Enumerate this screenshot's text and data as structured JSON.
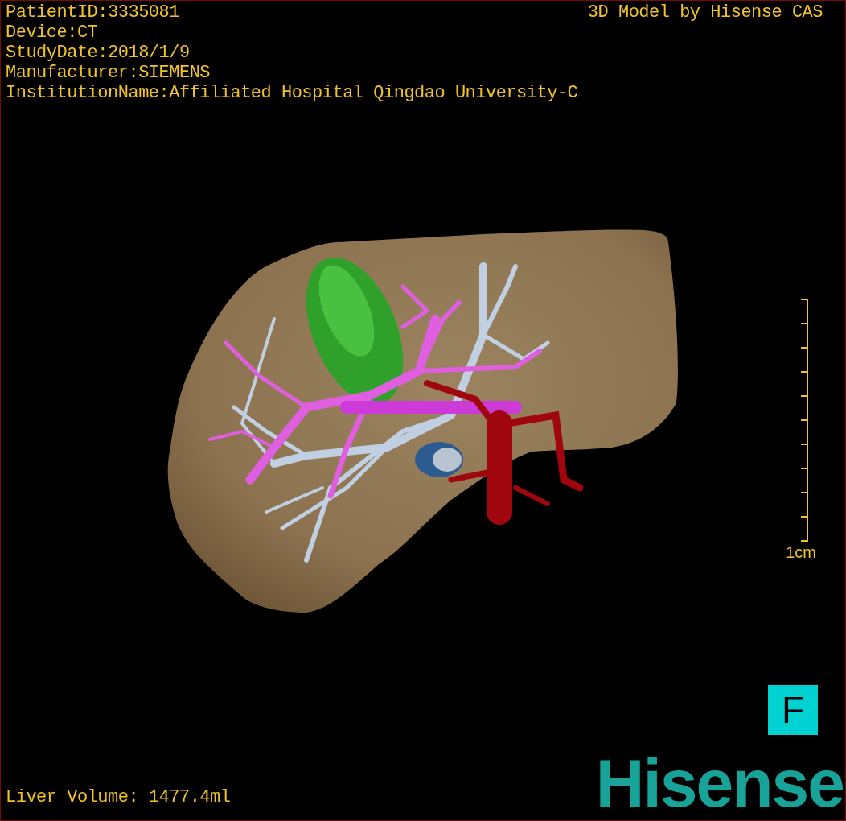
{
  "study_info": [
    "PatientID:3335081",
    "Device:CT",
    "StudyDate:2018/1/9",
    "Manufacturer:SIEMENS",
    "InstitutionName:Affiliated Hospital Qingdao University-C"
  ],
  "model_credit": "3D Model by Hisense CAS",
  "scale_bar": {
    "label": "1cm"
  },
  "liver_volume": "Liver Volume: 1477.4ml",
  "view_orientation": "F",
  "logo": "Hisense"
}
